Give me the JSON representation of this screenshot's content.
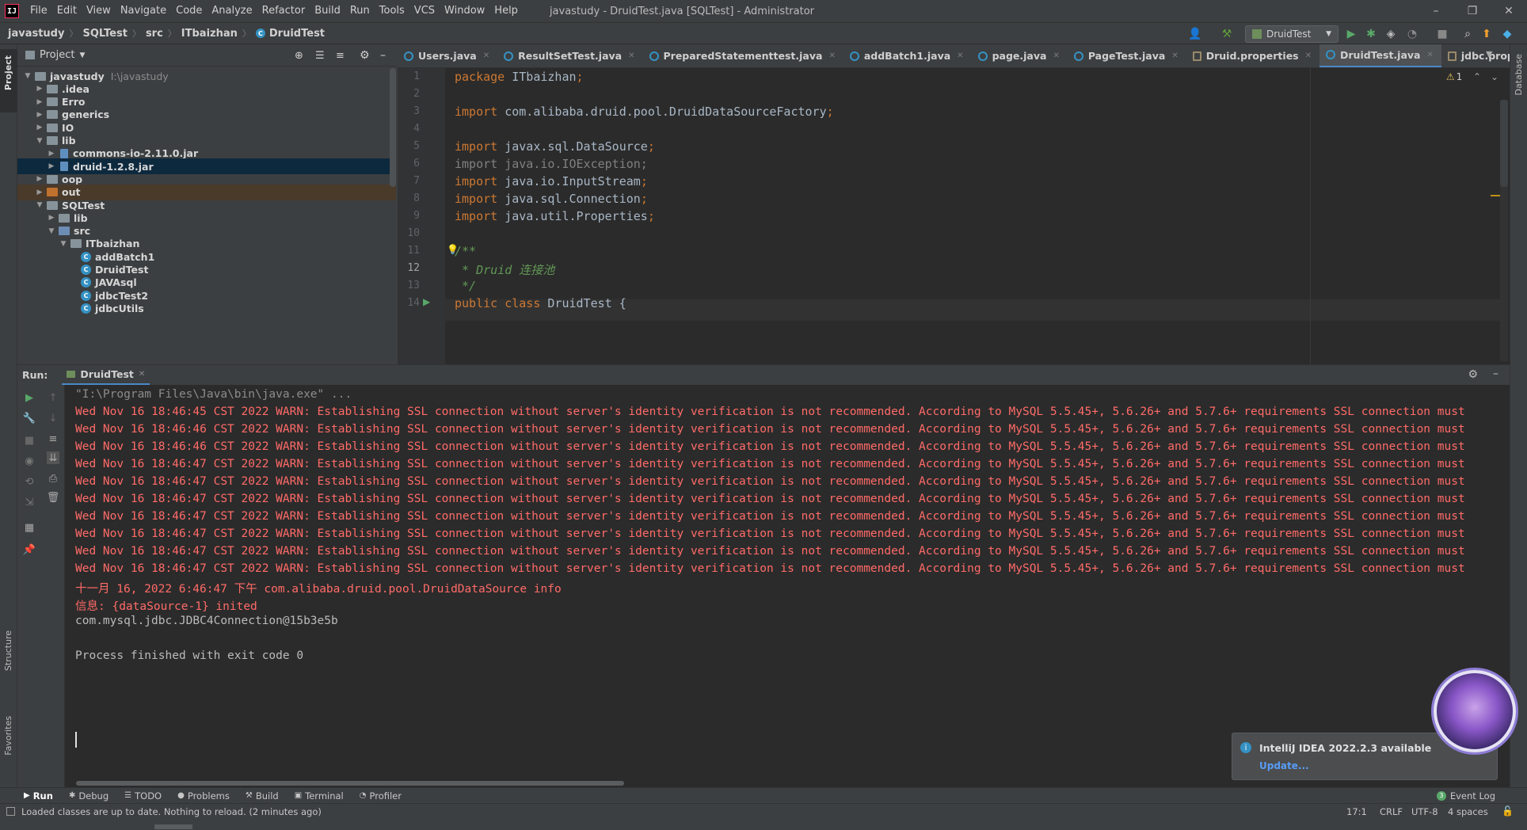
{
  "app": {
    "logo_text": "IJ",
    "menu": [
      "File",
      "Edit",
      "View",
      "Navigate",
      "Code",
      "Analyze",
      "Refactor",
      "Build",
      "Run",
      "Tools",
      "VCS",
      "Window",
      "Help"
    ],
    "window_title": "javastudy - DruidTest.java [SQLTest] - Administrator"
  },
  "breadcrumbs": [
    "javastudy",
    "SQLTest",
    "src",
    "ITbaizhan",
    "DruidTest"
  ],
  "run_config": "DruidTest",
  "left_stripe": {
    "project": "Project",
    "structure": "Structure",
    "favorites": "Favorites"
  },
  "right_stripe": {
    "database": "Database"
  },
  "project": {
    "title": "Project",
    "tree": [
      {
        "label": "javastudy",
        "path": "I:\\javastudy",
        "arrow": "▼",
        "icon": "folder",
        "depth": 0
      },
      {
        "label": ".idea",
        "arrow": "▶",
        "icon": "folder",
        "depth": 1
      },
      {
        "label": "Erro",
        "arrow": "▶",
        "icon": "folder",
        "depth": 1
      },
      {
        "label": "generics",
        "arrow": "▶",
        "icon": "folder",
        "depth": 1
      },
      {
        "label": "IO",
        "arrow": "▶",
        "icon": "folder",
        "depth": 1
      },
      {
        "label": "lib",
        "arrow": "▼",
        "icon": "folder",
        "depth": 1
      },
      {
        "label": "commons-io-2.11.0.jar",
        "arrow": "▶",
        "icon": "jar",
        "depth": 2
      },
      {
        "label": "druid-1.2.8.jar",
        "arrow": "▶",
        "icon": "jar",
        "depth": 2,
        "selected": true
      },
      {
        "label": "oop",
        "arrow": "▶",
        "icon": "folder",
        "depth": 1
      },
      {
        "label": "out",
        "arrow": "▶",
        "icon": "folder-orange",
        "depth": 1,
        "highlight": true
      },
      {
        "label": "SQLTest",
        "arrow": "▼",
        "icon": "folder",
        "depth": 1
      },
      {
        "label": "lib",
        "arrow": "▶",
        "icon": "folder",
        "depth": 2
      },
      {
        "label": "src",
        "arrow": "▼",
        "icon": "folder-blue",
        "depth": 2
      },
      {
        "label": "ITbaizhan",
        "arrow": "▼",
        "icon": "folder",
        "depth": 3
      },
      {
        "label": "addBatch1",
        "arrow": "",
        "icon": "class",
        "depth": 4
      },
      {
        "label": "DruidTest",
        "arrow": "",
        "icon": "class",
        "depth": 4
      },
      {
        "label": "JAVAsql",
        "arrow": "",
        "icon": "class",
        "depth": 4
      },
      {
        "label": "jdbcTest2",
        "arrow": "",
        "icon": "class",
        "depth": 4
      },
      {
        "label": "jdbcUtils",
        "arrow": "",
        "icon": "class",
        "depth": 4
      }
    ]
  },
  "editor": {
    "tabs": [
      {
        "label": "Users.java",
        "type": "class"
      },
      {
        "label": "ResultSetTest.java",
        "type": "class"
      },
      {
        "label": "PreparedStatementtest.java",
        "type": "class"
      },
      {
        "label": "addBatch1.java",
        "type": "class"
      },
      {
        "label": "page.java",
        "type": "class"
      },
      {
        "label": "PageTest.java",
        "type": "class"
      },
      {
        "label": "Druid.properties",
        "type": "prop"
      },
      {
        "label": "DruidTest.java",
        "type": "class",
        "active": true
      },
      {
        "label": "jdbc.propertie",
        "type": "prop"
      }
    ],
    "warning_count": "1",
    "lines": [
      {
        "n": "1",
        "parts": [
          [
            "kw",
            "package "
          ],
          [
            "",
            "ITbaizhan"
          ],
          [
            "kw",
            ";"
          ]
        ]
      },
      {
        "n": "2",
        "parts": []
      },
      {
        "n": "3",
        "parts": [
          [
            "kw",
            "import "
          ],
          [
            "",
            "com.alibaba.druid.pool.DruidDataSourceFactory"
          ],
          [
            "kw",
            ";"
          ]
        ]
      },
      {
        "n": "4",
        "parts": []
      },
      {
        "n": "5",
        "parts": [
          [
            "kw",
            "import "
          ],
          [
            "",
            "javax.sql.DataSource"
          ],
          [
            "kw",
            ";"
          ]
        ]
      },
      {
        "n": "6",
        "parts": [
          [
            "gr",
            "import java.io.IOException;"
          ]
        ]
      },
      {
        "n": "7",
        "parts": [
          [
            "kw",
            "import "
          ],
          [
            "",
            "java.io.InputStream"
          ],
          [
            "kw",
            ";"
          ]
        ]
      },
      {
        "n": "8",
        "parts": [
          [
            "kw",
            "import "
          ],
          [
            "",
            "java.sql.Connection"
          ],
          [
            "kw",
            ";"
          ]
        ]
      },
      {
        "n": "9",
        "parts": [
          [
            "kw",
            "import "
          ],
          [
            "",
            "java.util.Properties"
          ],
          [
            "kw",
            ";"
          ]
        ]
      },
      {
        "n": "10",
        "parts": []
      },
      {
        "n": "11",
        "parts": [
          [
            "cm",
            "/**"
          ]
        ]
      },
      {
        "n": "12",
        "parts": [
          [
            "cm",
            " * Druid 连接池"
          ]
        ]
      },
      {
        "n": "13",
        "parts": [
          [
            "cm",
            " */"
          ]
        ]
      },
      {
        "n": "14",
        "parts": [
          [
            "kw",
            "public class "
          ],
          [
            "",
            "DruidTest {"
          ]
        ]
      }
    ]
  },
  "run": {
    "label": "Run:",
    "tab": "DruidTest",
    "console": [
      {
        "type": "cmd",
        "text": "\"I:\\Program Files\\Java\\bin\\java.exe\" ..."
      },
      {
        "type": "err",
        "text": "Wed Nov 16 18:46:45 CST 2022 WARN: Establishing SSL connection without server's identity verification is not recommended. According to MySQL 5.5.45+, 5.6.26+ and 5.7.6+ requirements SSL connection must"
      },
      {
        "type": "err",
        "text": "Wed Nov 16 18:46:46 CST 2022 WARN: Establishing SSL connection without server's identity verification is not recommended. According to MySQL 5.5.45+, 5.6.26+ and 5.7.6+ requirements SSL connection must"
      },
      {
        "type": "err",
        "text": "Wed Nov 16 18:46:46 CST 2022 WARN: Establishing SSL connection without server's identity verification is not recommended. According to MySQL 5.5.45+, 5.6.26+ and 5.7.6+ requirements SSL connection must"
      },
      {
        "type": "err",
        "text": "Wed Nov 16 18:46:47 CST 2022 WARN: Establishing SSL connection without server's identity verification is not recommended. According to MySQL 5.5.45+, 5.6.26+ and 5.7.6+ requirements SSL connection must"
      },
      {
        "type": "err",
        "text": "Wed Nov 16 18:46:47 CST 2022 WARN: Establishing SSL connection without server's identity verification is not recommended. According to MySQL 5.5.45+, 5.6.26+ and 5.7.6+ requirements SSL connection must"
      },
      {
        "type": "err",
        "text": "Wed Nov 16 18:46:47 CST 2022 WARN: Establishing SSL connection without server's identity verification is not recommended. According to MySQL 5.5.45+, 5.6.26+ and 5.7.6+ requirements SSL connection must"
      },
      {
        "type": "err",
        "text": "Wed Nov 16 18:46:47 CST 2022 WARN: Establishing SSL connection without server's identity verification is not recommended. According to MySQL 5.5.45+, 5.6.26+ and 5.7.6+ requirements SSL connection must"
      },
      {
        "type": "err",
        "text": "Wed Nov 16 18:46:47 CST 2022 WARN: Establishing SSL connection without server's identity verification is not recommended. According to MySQL 5.5.45+, 5.6.26+ and 5.7.6+ requirements SSL connection must"
      },
      {
        "type": "err",
        "text": "Wed Nov 16 18:46:47 CST 2022 WARN: Establishing SSL connection without server's identity verification is not recommended. According to MySQL 5.5.45+, 5.6.26+ and 5.7.6+ requirements SSL connection must"
      },
      {
        "type": "err",
        "text": "Wed Nov 16 18:46:47 CST 2022 WARN: Establishing SSL connection without server's identity verification is not recommended. According to MySQL 5.5.45+, 5.6.26+ and 5.7.6+ requirements SSL connection must"
      },
      {
        "type": "err",
        "text": "十一月 16, 2022 6:46:47 下午 com.alibaba.druid.pool.DruidDataSource info"
      },
      {
        "type": "err",
        "text": "信息: {dataSource-1} inited"
      },
      {
        "type": "out",
        "text": "com.mysql.jdbc.JDBC4Connection@15b3e5b"
      },
      {
        "type": "out",
        "text": ""
      },
      {
        "type": "out",
        "text": "Process finished with exit code 0"
      }
    ]
  },
  "notification": {
    "title": "IntelliJ IDEA 2022.2.3 available",
    "link": "Update..."
  },
  "toolstrip": [
    {
      "label": "Run",
      "icon": "▶",
      "active": true
    },
    {
      "label": "Debug",
      "icon": "✱"
    },
    {
      "label": "TODO",
      "icon": "☰"
    },
    {
      "label": "Problems",
      "icon": "●"
    },
    {
      "label": "Build",
      "icon": "⚒"
    },
    {
      "label": "Terminal",
      "icon": "▣"
    },
    {
      "label": "Profiler",
      "icon": "◔"
    }
  ],
  "event_log": {
    "badge": "3",
    "label": "Event Log"
  },
  "status": {
    "message": "Loaded classes are up to date. Nothing to reload. (2 minutes ago)",
    "position": "17:1",
    "line_sep": "CRLF",
    "encoding": "UTF-8",
    "indent": "4 spaces"
  },
  "colors": {
    "error": "#ff6b68",
    "keyword": "#cc7832",
    "comment": "#629755",
    "accent": "#4a88c7"
  }
}
